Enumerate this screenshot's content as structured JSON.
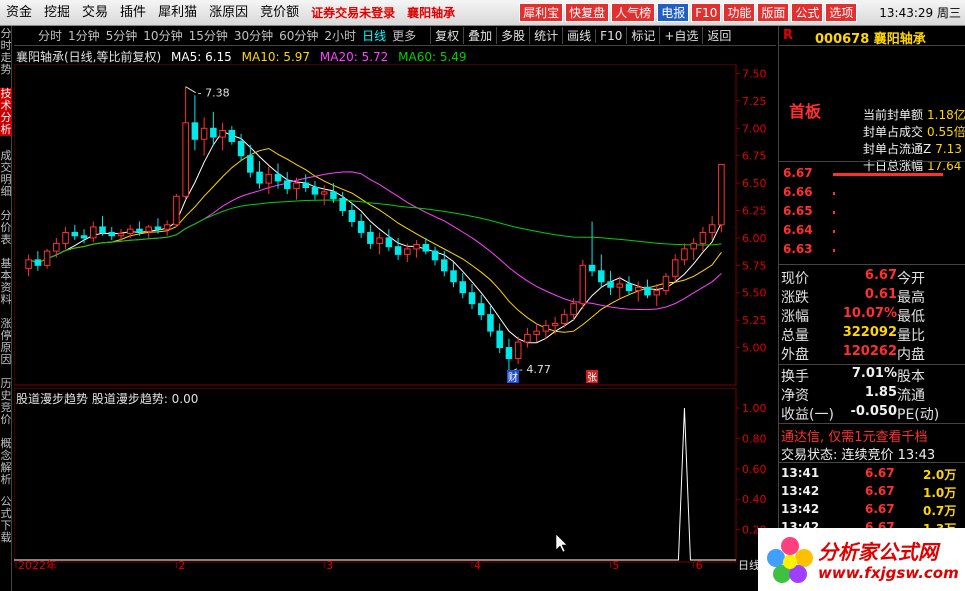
{
  "menubar": {
    "items": [
      "资金",
      "挖掘",
      "交易",
      "插件",
      "犀利猫",
      "涨原因",
      "竞价额"
    ],
    "notice": "证券交易未登录",
    "stock_name": "襄阳轴承",
    "quick": [
      {
        "label": "犀利宝",
        "color": "#e03030"
      },
      {
        "label": "快复盘",
        "color": "#e03030"
      },
      {
        "label": "人气榜",
        "color": "#e03030"
      },
      {
        "label": "电报",
        "color": "#2060c0"
      },
      {
        "label": "F10",
        "color": "#e03030"
      },
      {
        "label": "功能",
        "color": "#e03030"
      },
      {
        "label": "版面",
        "color": "#e03030"
      },
      {
        "label": "公式",
        "color": "#e03030"
      },
      {
        "label": "选项",
        "color": "#e03030"
      }
    ],
    "time": "13:43:29 周三"
  },
  "lefttabs": [
    {
      "label": "分时走势",
      "active": false
    },
    {
      "label": "技术分析",
      "active": true
    },
    {
      "label": "成交明细",
      "active": false
    },
    {
      "label": "分价表",
      "active": false
    },
    {
      "label": "基本资料",
      "active": false
    },
    {
      "label": "涨停原因",
      "active": false
    },
    {
      "label": "历史竞价",
      "active": false
    },
    {
      "label": "概念解析",
      "active": false
    },
    {
      "label": "公式下载",
      "active": false
    }
  ],
  "toolbar": {
    "periods": [
      "分时",
      "1分钟",
      "5分钟",
      "10分钟",
      "15分钟",
      "30分钟",
      "60分钟",
      "2小时",
      "日线",
      "更多"
    ],
    "active_period": "日线",
    "buttons": [
      "复权",
      "叠加",
      "多股",
      "统计",
      "画线",
      "F10",
      "标记",
      "+自选",
      "返回"
    ]
  },
  "main_header": {
    "title": "襄阳轴承(日线,等比前复权)",
    "ma5": "MA5: 6.15",
    "ma10": "MA10: 5.97",
    "ma20": "MA20: 5.72",
    "ma60": "MA60: 5.49",
    "ma5_color": "#ffffff",
    "ma10_color": "#ffd700",
    "ma20_color": "#ff40ff",
    "ma60_color": "#00d000"
  },
  "chart_data": {
    "type": "candlestick",
    "price_axis": [
      "7.50",
      "7.25",
      "7.00",
      "6.75",
      "6.50",
      "6.25",
      "6.00",
      "5.75",
      "5.50",
      "5.25",
      "5.00"
    ],
    "ylim": [
      4.85,
      7.55
    ],
    "annotations": {
      "high": "7.38",
      "low": "4.77",
      "mark1": "财",
      "mark2": "张"
    },
    "months": [
      "2022年",
      "2",
      "3",
      "4",
      "5",
      "6"
    ],
    "candles": [
      [
        5.72,
        5.85,
        5.65,
        5.8
      ],
      [
        5.8,
        5.88,
        5.7,
        5.75
      ],
      [
        5.75,
        5.9,
        5.72,
        5.88
      ],
      [
        5.88,
        6.0,
        5.82,
        5.95
      ],
      [
        5.95,
        6.1,
        5.9,
        6.05
      ],
      [
        6.05,
        6.12,
        5.98,
        6.02
      ],
      [
        6.02,
        6.08,
        5.95,
        6.0
      ],
      [
        6.0,
        6.15,
        5.96,
        6.1
      ],
      [
        6.1,
        6.2,
        6.02,
        6.05
      ],
      [
        6.05,
        6.1,
        5.98,
        6.02
      ],
      [
        6.02,
        6.08,
        5.96,
        6.04
      ],
      [
        6.04,
        6.12,
        6.0,
        6.08
      ],
      [
        6.08,
        6.15,
        6.02,
        6.06
      ],
      [
        6.06,
        6.12,
        6.0,
        6.1
      ],
      [
        6.1,
        6.18,
        6.04,
        6.08
      ],
      [
        6.08,
        6.16,
        6.02,
        6.12
      ],
      [
        6.12,
        6.4,
        6.1,
        6.38
      ],
      [
        6.38,
        7.38,
        6.35,
        7.05
      ],
      [
        7.05,
        7.3,
        6.8,
        6.9
      ],
      [
        6.9,
        7.1,
        6.75,
        7.0
      ],
      [
        7.0,
        7.15,
        6.85,
        6.92
      ],
      [
        6.92,
        7.05,
        6.8,
        6.98
      ],
      [
        6.98,
        7.02,
        6.85,
        6.88
      ],
      [
        6.88,
        6.95,
        6.7,
        6.75
      ],
      [
        6.75,
        6.85,
        6.55,
        6.6
      ],
      [
        6.6,
        6.7,
        6.45,
        6.5
      ],
      [
        6.5,
        6.65,
        6.4,
        6.58
      ],
      [
        6.58,
        6.68,
        6.45,
        6.52
      ],
      [
        6.52,
        6.6,
        6.4,
        6.45
      ],
      [
        6.45,
        6.55,
        6.35,
        6.5
      ],
      [
        6.5,
        6.58,
        6.42,
        6.46
      ],
      [
        6.46,
        6.52,
        6.35,
        6.4
      ],
      [
        6.4,
        6.48,
        6.3,
        6.42
      ],
      [
        6.42,
        6.5,
        6.32,
        6.36
      ],
      [
        6.36,
        6.42,
        6.2,
        6.25
      ],
      [
        6.25,
        6.32,
        6.1,
        6.15
      ],
      [
        6.15,
        6.22,
        6.0,
        6.05
      ],
      [
        6.05,
        6.12,
        5.9,
        5.95
      ],
      [
        5.95,
        6.05,
        5.85,
        6.0
      ],
      [
        6.0,
        6.08,
        5.88,
        5.92
      ],
      [
        5.92,
        6.0,
        5.8,
        5.85
      ],
      [
        5.85,
        5.95,
        5.78,
        5.9
      ],
      [
        5.9,
        5.98,
        5.82,
        5.94
      ],
      [
        5.94,
        6.0,
        5.85,
        5.88
      ],
      [
        5.88,
        5.92,
        5.75,
        5.8
      ],
      [
        5.8,
        5.88,
        5.65,
        5.7
      ],
      [
        5.7,
        5.78,
        5.55,
        5.6
      ],
      [
        5.6,
        5.68,
        5.45,
        5.5
      ],
      [
        5.5,
        5.58,
        5.35,
        5.4
      ],
      [
        5.4,
        5.48,
        5.25,
        5.3
      ],
      [
        5.3,
        5.38,
        5.1,
        5.15
      ],
      [
        5.15,
        5.22,
        4.95,
        5.0
      ],
      [
        5.0,
        5.08,
        4.77,
        4.9
      ],
      [
        4.9,
        5.1,
        4.85,
        5.05
      ],
      [
        5.05,
        5.18,
        5.0,
        5.12
      ],
      [
        5.12,
        5.22,
        5.05,
        5.15
      ],
      [
        5.15,
        5.25,
        5.08,
        5.2
      ],
      [
        5.2,
        5.28,
        5.12,
        5.22
      ],
      [
        5.22,
        5.35,
        5.18,
        5.3
      ],
      [
        5.3,
        5.45,
        5.25,
        5.4
      ],
      [
        5.4,
        5.8,
        5.35,
        5.75
      ],
      [
        5.75,
        6.15,
        5.65,
        5.7
      ],
      [
        5.7,
        5.85,
        5.55,
        5.6
      ],
      [
        5.6,
        5.7,
        5.48,
        5.55
      ],
      [
        5.55,
        5.65,
        5.45,
        5.58
      ],
      [
        5.58,
        5.65,
        5.48,
        5.52
      ],
      [
        5.52,
        5.6,
        5.42,
        5.55
      ],
      [
        5.55,
        5.62,
        5.45,
        5.48
      ],
      [
        5.48,
        5.58,
        5.38,
        5.52
      ],
      [
        5.52,
        5.68,
        5.48,
        5.65
      ],
      [
        5.65,
        5.85,
        5.6,
        5.8
      ],
      [
        5.8,
        5.95,
        5.75,
        5.9
      ],
      [
        5.9,
        6.0,
        5.8,
        5.95
      ],
      [
        5.95,
        6.1,
        5.88,
        6.05
      ],
      [
        6.05,
        6.2,
        5.98,
        6.12
      ],
      [
        6.12,
        6.67,
        6.05,
        6.67
      ]
    ]
  },
  "indicator": {
    "header": "股道漫步趋势 股道漫步趋势: 0.00",
    "axis": [
      "1.00",
      "0.80",
      "0.60",
      "0.40",
      "0.20"
    ],
    "spike_index": 71,
    "spike_value": 1.0,
    "corner_label": "日线"
  },
  "rpanel": {
    "r_label": "R",
    "code": "000678 襄阳轴承",
    "board": "首板",
    "seal": [
      {
        "label": "当前封单额",
        "value": "1.18亿"
      },
      {
        "label": "封单占成交",
        "value": "0.55倍"
      },
      {
        "label": "封单占流通Z",
        "value": "7.13"
      },
      {
        "label": "十日总涨幅",
        "value": "17.64"
      }
    ],
    "order_book": [
      {
        "price": "6.67",
        "bar": 110
      },
      {
        "price": "6.66",
        "bar": 2
      },
      {
        "price": "6.65",
        "bar": 2
      },
      {
        "price": "6.64",
        "bar": 2
      },
      {
        "price": "6.63",
        "bar": 2
      }
    ],
    "quote": [
      {
        "l1": "现价",
        "v1": "6.67",
        "c1": "red",
        "l2": "今开"
      },
      {
        "l1": "涨跌",
        "v1": "0.61",
        "c1": "red",
        "l2": "最高"
      },
      {
        "l1": "涨幅",
        "v1": "10.07%",
        "c1": "red",
        "l2": "最低"
      },
      {
        "l1": "总量",
        "v1": "322092",
        "c1": "yel",
        "l2": "量比"
      },
      {
        "l1": "外盘",
        "v1": "120262",
        "c1": "red",
        "l2": "内盘"
      }
    ],
    "quote2": [
      {
        "l1": "换手",
        "v1": "7.01%",
        "c1": "wht",
        "l2": "股本"
      },
      {
        "l1": "净资",
        "v1": "1.85",
        "c1": "wht",
        "l2": "流通"
      },
      {
        "l1": "收益(一)",
        "v1": "-0.050",
        "c1": "wht",
        "l2": "PE(动)"
      }
    ],
    "promo": "通达信, 仅需1元查看千档",
    "trade_status": "交易状态: 连续竞价",
    "trade_status_time": "13:43",
    "ticks": [
      {
        "time": "13:41",
        "price": "6.67",
        "vol": "2.0万"
      },
      {
        "time": "13:42",
        "price": "6.67",
        "vol": "1.0万"
      },
      {
        "time": "13:42",
        "price": "6.67",
        "vol": "0.7万"
      },
      {
        "time": "13:42",
        "price": "6.67",
        "vol": "1.3万"
      }
    ]
  },
  "logo": {
    "line1": "分析家公式网",
    "line2": "www.fxjgsw.com"
  }
}
